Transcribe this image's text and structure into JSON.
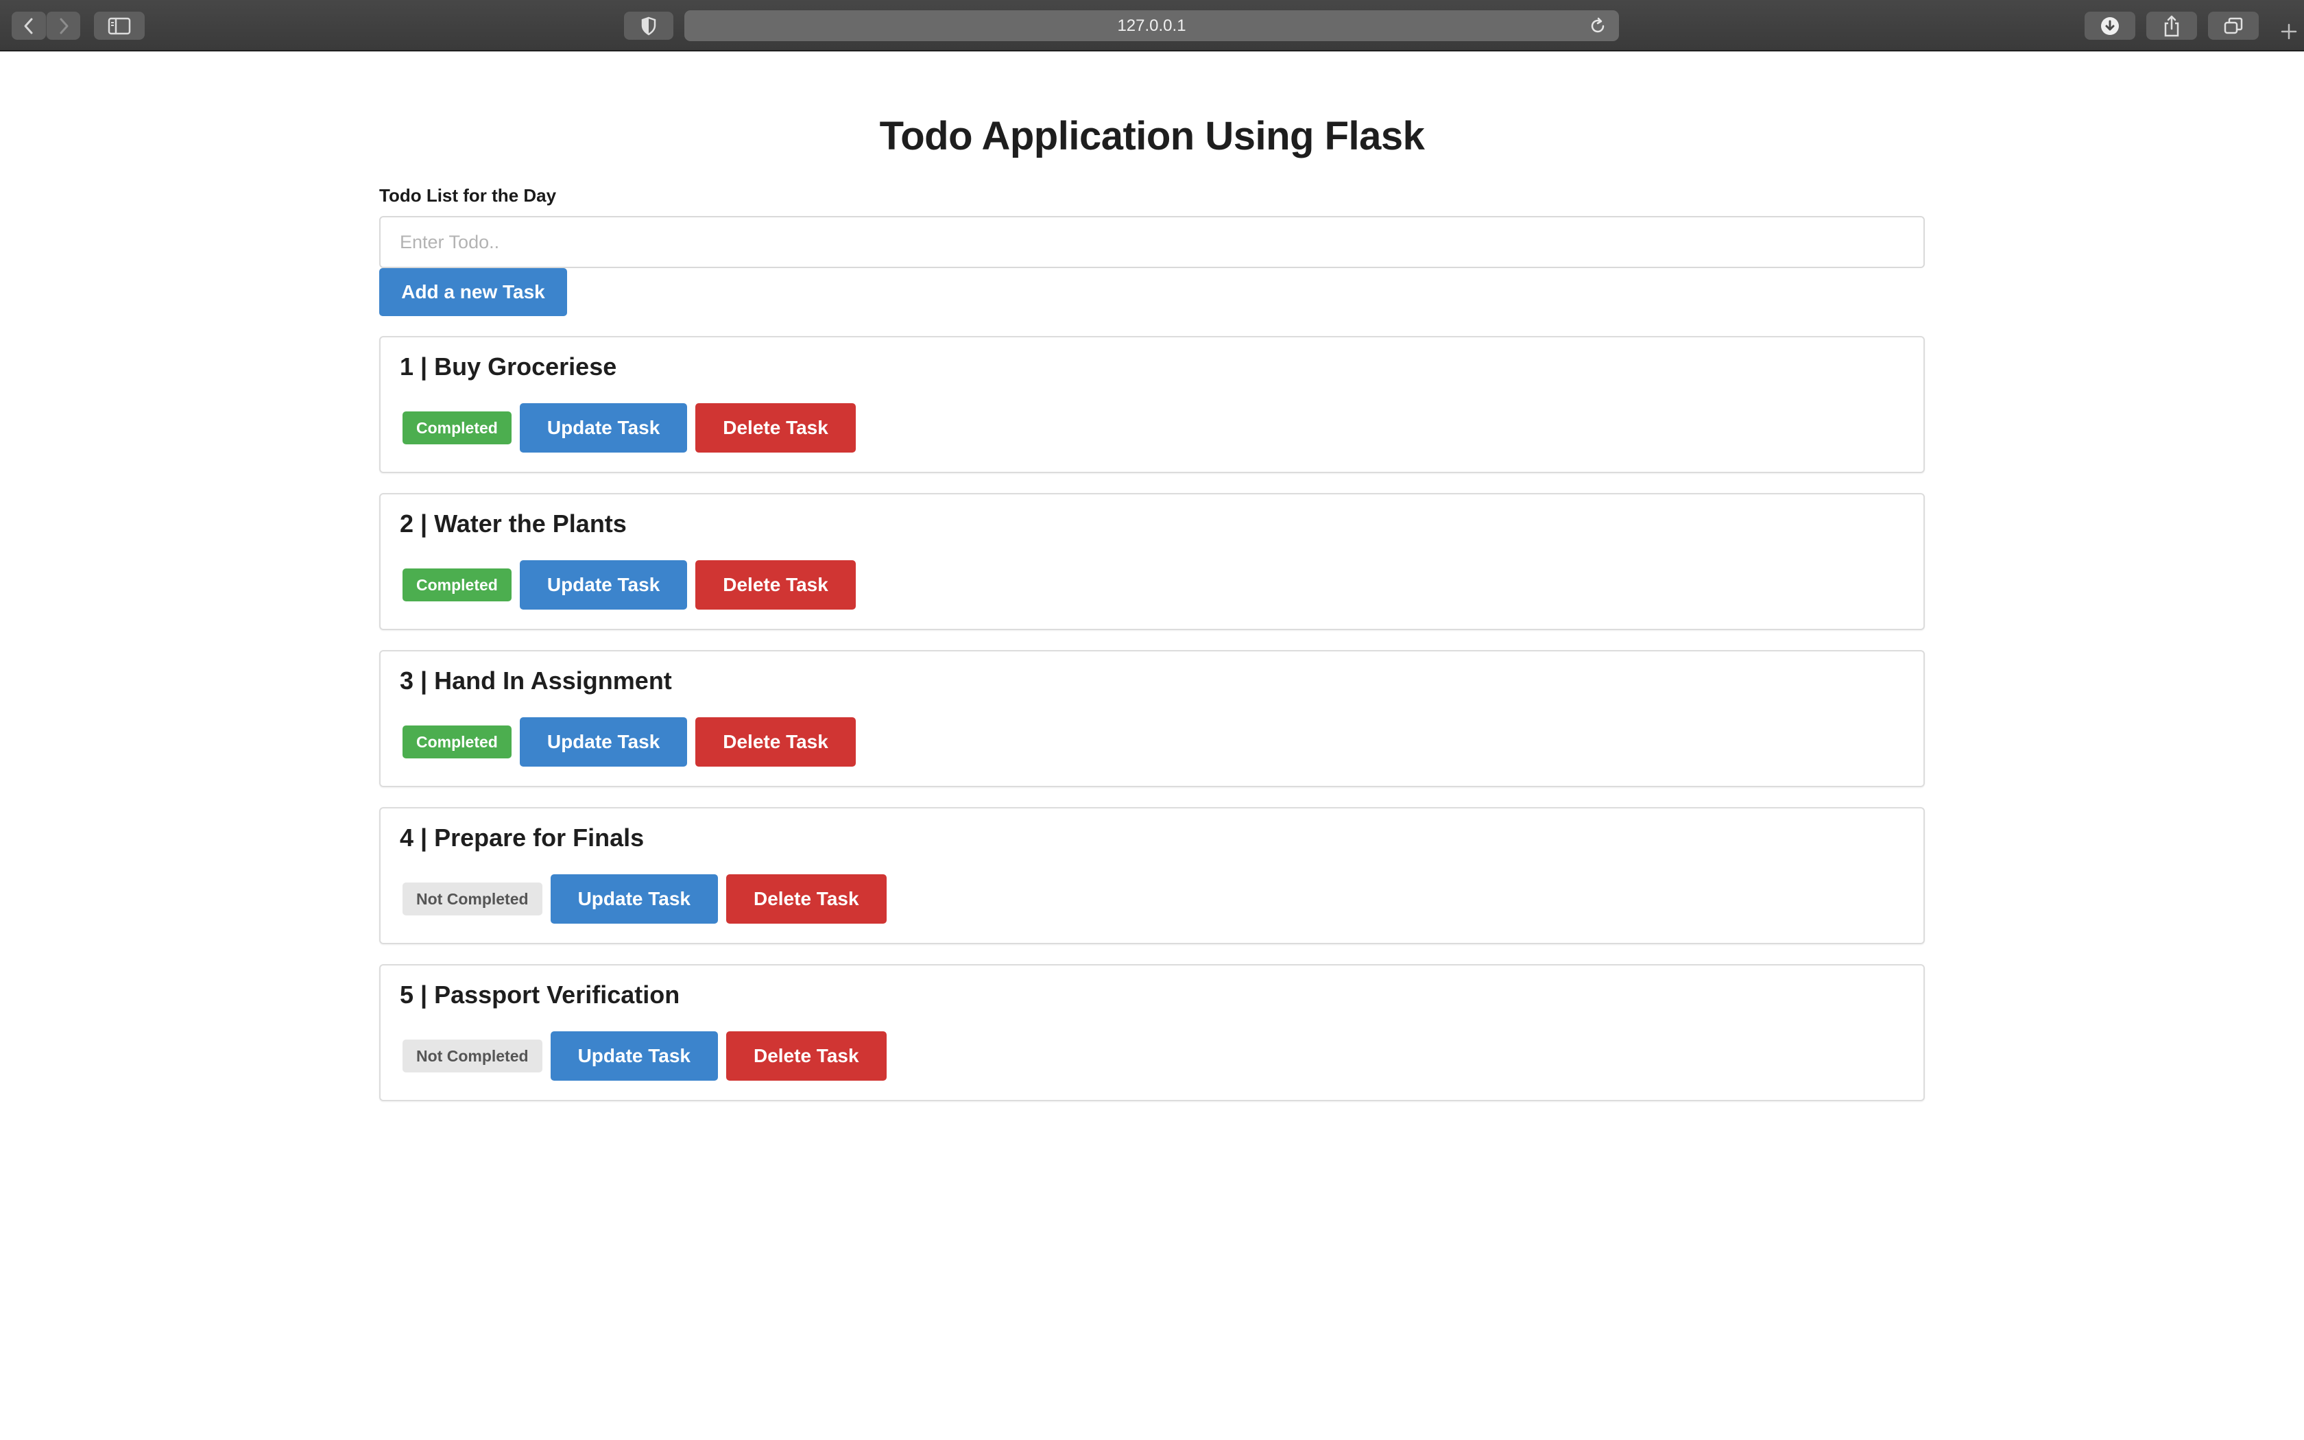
{
  "browser": {
    "url": "127.0.0.1"
  },
  "page": {
    "title": "Todo Application Using Flask",
    "field_label": "Todo List for the Day",
    "input": {
      "value": "",
      "placeholder": "Enter Todo.."
    },
    "add_button_label": "Add a new Task"
  },
  "tasks": [
    {
      "title": "1 | Buy Groceriese",
      "status": "Completed",
      "completed": true,
      "update_label": "Update Task",
      "delete_label": "Delete Task"
    },
    {
      "title": "2 | Water the Plants",
      "status": "Completed",
      "completed": true,
      "update_label": "Update Task",
      "delete_label": "Delete Task"
    },
    {
      "title": "3 | Hand In Assignment",
      "status": "Completed",
      "completed": true,
      "update_label": "Update Task",
      "delete_label": "Delete Task"
    },
    {
      "title": "4 | Prepare for Finals",
      "status": "Not Completed",
      "completed": false,
      "update_label": "Update Task",
      "delete_label": "Delete Task"
    },
    {
      "title": "5 | Passport Verification",
      "status": "Not Completed",
      "completed": false,
      "update_label": "Update Task",
      "delete_label": "Delete Task"
    }
  ],
  "colors": {
    "primary": "#3c84cc",
    "danger": "#d03533",
    "success": "#4cae4f",
    "muted": "#e6e6e6"
  }
}
